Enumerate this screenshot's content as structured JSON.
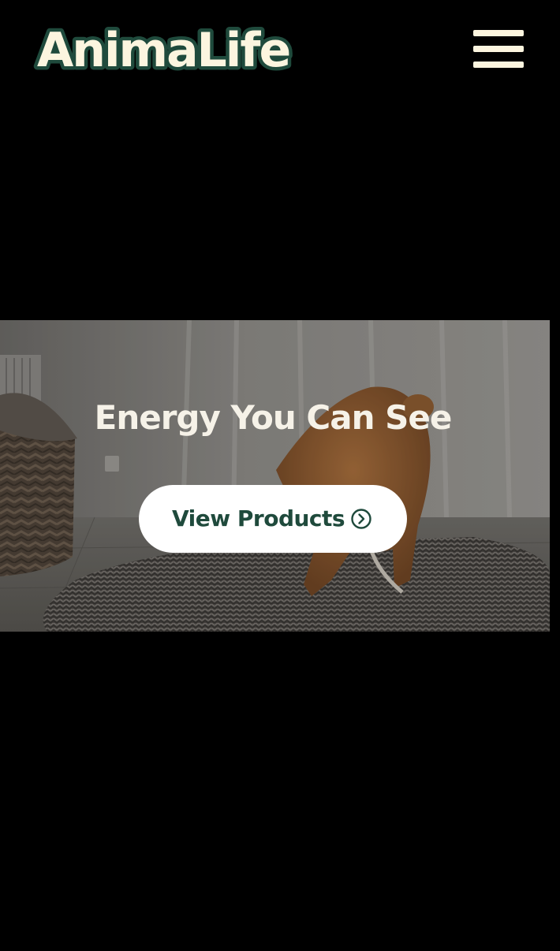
{
  "colors": {
    "page_background": "#000000",
    "brand_green": "#1f4a3c",
    "cream": "#fcf5df",
    "button_background": "#ffffff",
    "heading_text": "#f6f2e8"
  },
  "header": {
    "logo_text": "AnimaLife",
    "logo_icon": "animalife-wordmark-logo",
    "menu_icon": "hamburger-menu-icon"
  },
  "hero": {
    "background_image": "dog-playing-on-shag-rug-photo",
    "heading": "Energy You Can See",
    "cta_label": "View Products",
    "cta_icon": "chevron-right-circle-icon"
  }
}
